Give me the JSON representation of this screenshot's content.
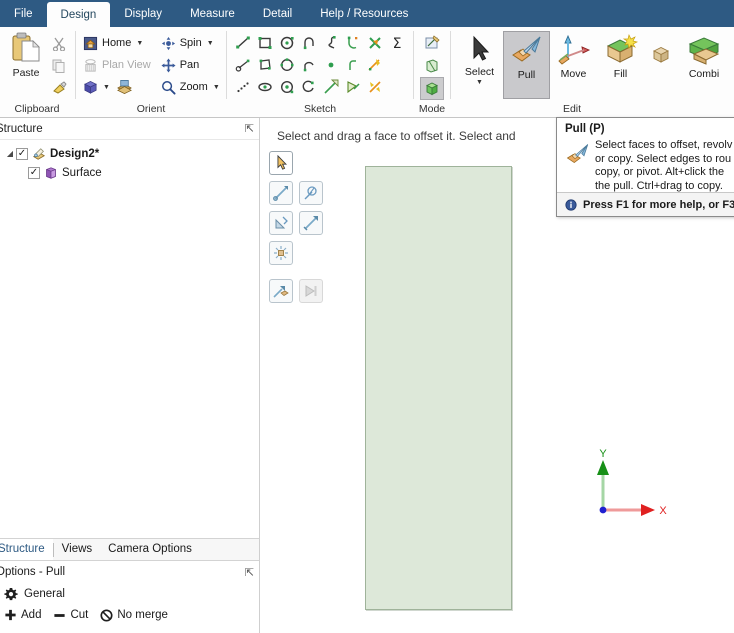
{
  "tabs": [
    {
      "label": "File",
      "active": false
    },
    {
      "label": "Design",
      "active": true
    },
    {
      "label": "Display",
      "active": false
    },
    {
      "label": "Measure",
      "active": false
    },
    {
      "label": "Detail",
      "active": false
    },
    {
      "label": "Help / Resources",
      "active": false
    }
  ],
  "ribbon": {
    "clipboard": {
      "label": "Clipboard",
      "paste": "Paste",
      "cut_icon": "scissors-icon",
      "copy_icon": "copy-icon",
      "format_painter_icon": "paintbrush-icon"
    },
    "orient": {
      "label": "Orient",
      "items": [
        {
          "label": "Home",
          "icon": "home-icon",
          "caret": true,
          "disabled": false
        },
        {
          "label": "Spin",
          "icon": "spin-icon",
          "caret": true,
          "disabled": false
        },
        {
          "label": "Plan View",
          "icon": "plan-view-icon",
          "caret": false,
          "disabled": true
        },
        {
          "label": "Pan",
          "icon": "pan-icon",
          "caret": false,
          "disabled": false
        },
        {
          "label": "",
          "icon": "iso-cube-icon",
          "caret": true,
          "disabled": false
        },
        {
          "label": "",
          "icon": "view-layers-icon",
          "caret": false,
          "disabled": false
        },
        {
          "label": "Zoom",
          "icon": "magnifier-icon",
          "caret": true,
          "disabled": false
        }
      ]
    },
    "sketch": {
      "label": "Sketch",
      "icons": [
        "line-icon",
        "rectangle-icon",
        "circle-icon",
        "tangent-arc-icon",
        "spline-icon",
        "corner-arc-icon",
        "trim-away-icon",
        "sum-icon",
        "construction-line-icon",
        "polygon-icon",
        "polygon-circle-icon",
        "three-point-arc-icon",
        "point-icon",
        "fillet-corner-icon",
        "split-icon",
        "",
        "dotted-line-icon",
        "ellipse-icon",
        "ellipse-arc-icon",
        "sweep-arc-icon",
        "select-sketch-icon",
        "project-to-sketch-icon",
        "trim-icon",
        ""
      ]
    },
    "mode": {
      "label": "Mode",
      "buttons": [
        {
          "icon": "sketch-mode-icon",
          "selected": false
        },
        {
          "icon": "section-mode-icon",
          "selected": false
        },
        {
          "icon": "solid-mode-icon",
          "selected": true
        }
      ]
    },
    "edit": {
      "label": "Edit",
      "buttons": [
        {
          "label": "Select",
          "icon": "arrow-cursor-icon",
          "selected": false,
          "caret": true
        },
        {
          "label": "Pull",
          "icon": "pull-icon",
          "selected": true,
          "caret": false
        },
        {
          "label": "Move",
          "icon": "move-icon",
          "selected": false,
          "caret": false
        },
        {
          "label": "Fill",
          "icon": "fill-icon",
          "selected": false,
          "caret": false
        },
        {
          "label": "",
          "icon": "small-box-icon",
          "selected": false,
          "caret": false
        },
        {
          "label": "Combi",
          "icon": "combine-icon",
          "selected": false,
          "caret": false
        }
      ]
    }
  },
  "structure_panel": {
    "title": "Structure",
    "pin_icon": "pin-icon",
    "tree": [
      {
        "label": "Design2*",
        "icon": "design-doc-icon",
        "checked": true,
        "bold": true,
        "level": 0,
        "expander": "expanded"
      },
      {
        "label": "Surface",
        "icon": "surface-icon",
        "checked": true,
        "bold": false,
        "level": 1,
        "expander": "none"
      }
    ]
  },
  "bottom_tabs": [
    {
      "label": "Structure",
      "active": true
    },
    {
      "label": "Views",
      "active": false
    },
    {
      "label": "Camera Options",
      "active": false
    }
  ],
  "options_panel": {
    "title": "Options - Pull",
    "pin_icon": "pin-icon",
    "section_label": "General",
    "section_icon": "gear-icon",
    "row": [
      {
        "label": "Add",
        "icon": "plus-icon"
      },
      {
        "label": "Cut",
        "icon": "minus-icon"
      },
      {
        "label": "No merge",
        "icon": "no-merge-icon"
      }
    ]
  },
  "viewport": {
    "status_text": "Select and drag a face to offset it. Select and",
    "mini_toolbar": [
      [
        {
          "icon": "arrow-cursor-icon",
          "selected": true,
          "disabled": false
        }
      ],
      [
        {
          "icon": "pull-direction-icon",
          "selected": false,
          "disabled": false
        },
        {
          "icon": "pull-rotate-icon",
          "selected": false,
          "disabled": false
        }
      ],
      [
        {
          "icon": "pull-scale-icon",
          "selected": false,
          "disabled": false
        },
        {
          "icon": "pull-offset-icon",
          "selected": false,
          "disabled": false
        }
      ],
      [
        {
          "icon": "pull-radial-icon",
          "selected": false,
          "disabled": false
        }
      ],
      [
        {
          "icon": "pull-copy-icon",
          "selected": false,
          "disabled": false
        },
        {
          "icon": "pull-next-icon",
          "selected": false,
          "disabled": true
        }
      ]
    ],
    "surface": {
      "name": "surface-body",
      "fill_color": "#dde8d9",
      "border_color": "#9fb39a"
    },
    "triad": {
      "x_label": "X",
      "y_label": "Y",
      "x_color": "#e02020",
      "y_color": "#179017",
      "origin_color": "#2020d0"
    }
  },
  "tooltip": {
    "title": "Pull (P)",
    "icon": "pull-icon",
    "lines": [
      "Select faces to offset, revolv",
      "or copy. Select edges to rou",
      "copy, or pivot. Alt+click the",
      "the pull. Ctrl+drag to copy."
    ],
    "footer_icon": "info-icon",
    "footer_text": "Press F1 for more help, or F3"
  },
  "colors": {
    "tabbar_bg": "#2e5a83",
    "ribbon_bg": "#fdfdfd",
    "selected_btn": "#c9c9cc",
    "accent": "#2e5a83"
  }
}
